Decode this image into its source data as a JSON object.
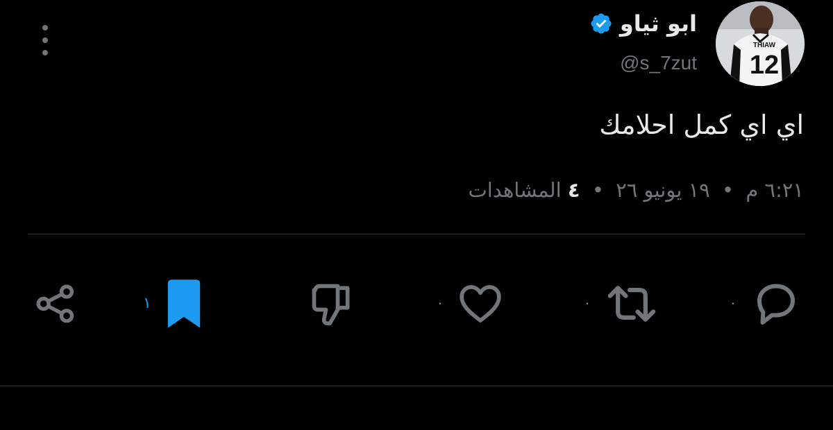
{
  "author": {
    "display_name": "ابو ثياو",
    "handle": "@s_7zut",
    "verified": true,
    "avatar_jersey_name": "THIAW",
    "avatar_jersey_number": "12"
  },
  "tweet": {
    "text": "اي اي كمل احلامك",
    "time": "٦:٢١ م",
    "date": "١٩ يونيو ٢٦",
    "views_count": "٤",
    "views_label": "المشاهدات",
    "separator": "•"
  },
  "actions": {
    "reply_count": "٠",
    "retweet_count": "٠",
    "like_count": "٠",
    "bookmark_count": "١"
  },
  "colors": {
    "background": "#000000",
    "text": "#e7e9ea",
    "secondary": "#71767b",
    "accent": "#1d9bf0",
    "divider": "#2f3336"
  }
}
